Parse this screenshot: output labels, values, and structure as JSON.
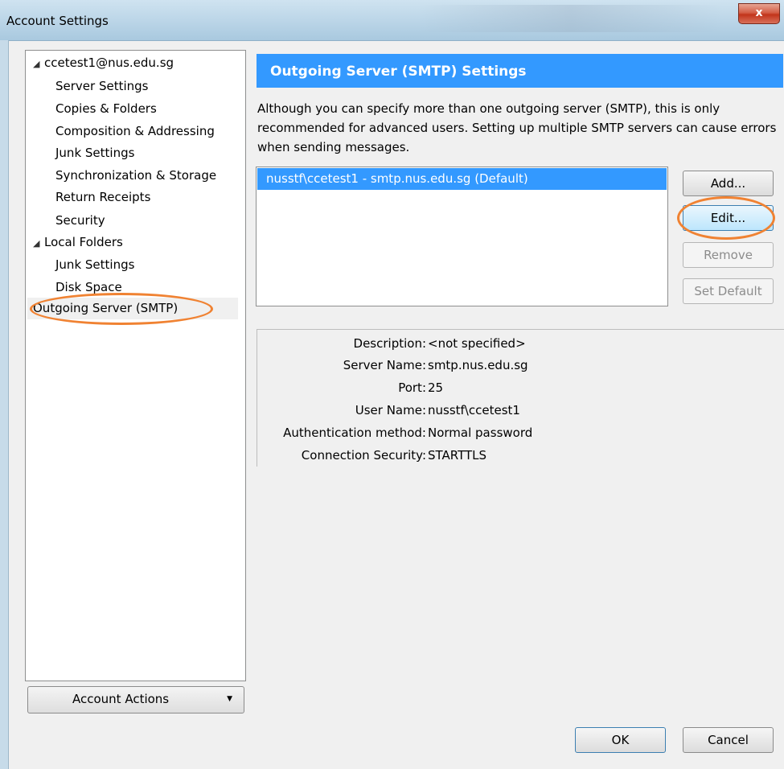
{
  "window": {
    "title": "Account Settings",
    "close_label": "x"
  },
  "tree": {
    "items": [
      {
        "label": "ccetest1@nus.edu.sg",
        "expanded": true
      },
      {
        "label": "Server Settings"
      },
      {
        "label": "Copies & Folders"
      },
      {
        "label": "Composition & Addressing"
      },
      {
        "label": "Junk Settings"
      },
      {
        "label": "Synchronization & Storage"
      },
      {
        "label": "Return Receipts"
      },
      {
        "label": "Security"
      },
      {
        "label": "Local Folders",
        "expanded": true
      },
      {
        "label": "Junk Settings"
      },
      {
        "label": "Disk Space"
      },
      {
        "label": "Outgoing Server (SMTP)",
        "selected": true
      }
    ],
    "twisty_glyph": "◢"
  },
  "account_actions": {
    "label": "Account Actions",
    "accesskey": "A",
    "arrow": "▼"
  },
  "panel": {
    "heading": "Outgoing Server (SMTP) Settings",
    "description": "Although you can specify more than one outgoing server (SMTP), this is only recommended for advanced users. Setting up multiple SMTP servers can cause errors when sending messages."
  },
  "servers": [
    {
      "label": "nusstf\\ccetest1 - smtp.nus.edu.sg (Default)",
      "selected": true
    }
  ],
  "buttons": {
    "add": "Add...",
    "edit": "Edit...",
    "remove": "Remove",
    "set_default": "Set Default",
    "ok": "OK",
    "cancel": "Cancel"
  },
  "details": [
    {
      "key": "Description:",
      "value": "<not specified>"
    },
    {
      "key": "Server Name:",
      "value": "smtp.nus.edu.sg"
    },
    {
      "key": "Port:",
      "value": "25"
    },
    {
      "key": "User Name:",
      "value": "nusstf\\ccetest1"
    },
    {
      "key": "Authentication method:",
      "value": "Normal password"
    },
    {
      "key": "Connection Security:",
      "value": "STARTTLS"
    }
  ],
  "colors": {
    "selection_blue": "#3399ff",
    "highlight_ellipse": "#f08232"
  }
}
